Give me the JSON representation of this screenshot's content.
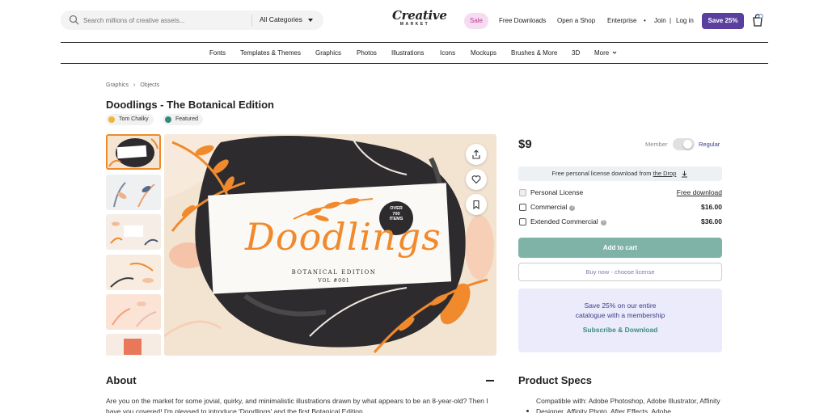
{
  "header": {
    "search_placeholder": "Search millions of creative assets...",
    "category_select": "All Categories",
    "logo_line1": "Creative",
    "logo_line2": "MARKET",
    "sale": "Sale",
    "free_downloads": "Free Downloads",
    "open_shop": "Open a Shop",
    "enterprise": "Enterprise",
    "bullet": "•",
    "join": "Join",
    "pipe": "|",
    "login": "Log in",
    "save_button": "Save 25%"
  },
  "category_nav": [
    "Fonts",
    "Templates & Themes",
    "Graphics",
    "Photos",
    "Illustrations",
    "Icons",
    "Mockups",
    "Brushes & More",
    "3D",
    "More"
  ],
  "breadcrumb": [
    "Graphics",
    "Objects"
  ],
  "product": {
    "title": "Doodlings - The Botanical Edition",
    "author": "Tom Chalky",
    "badge": "Featured",
    "hero_script": "Doodlings",
    "hero_subtitle": "BOTANICAL EDITION",
    "hero_volume": "VOL #001",
    "hero_badge_lines": [
      "OVER",
      "700",
      "ITEMS"
    ]
  },
  "purchase": {
    "price": "$9",
    "member_label": "Member",
    "regular_label": "Regular",
    "free_banner_text": "Free personal license download from ",
    "free_banner_link": "the Drop",
    "licenses": [
      {
        "name": "Personal License",
        "value": "Free download",
        "info": false
      },
      {
        "name": "Commercial",
        "value": "$16.00",
        "info": true
      },
      {
        "name": "Extended Commercial",
        "value": "$36.00",
        "info": true
      }
    ],
    "add_to_cart": "Add to cart",
    "buy_now": "Buy now - choose license",
    "promo_line1": "Save 25% on our entire",
    "promo_line2": "catalogue with a membership",
    "promo_cta": "Subscribe & Download"
  },
  "about": {
    "heading": "About",
    "text": "Are you on the market for some jovial, quirky, and minimalistic illustrations drawn by what appears to be an 8-year-old? Then I have you covered! I'm pleased to introduce 'Doodlings' and the first Botanical Edition."
  },
  "specs": {
    "heading": "Product Specs",
    "text": "Compatible with: Adobe Photoshop, Adobe Illustrator, Affinity Designer, Affinity Photo, After Effects, Adobe"
  },
  "colors": {
    "brand_purple": "#5a3f9e",
    "accent_orange": "#f08a2c",
    "cart_green": "#7fb3a8",
    "promo_bg": "#ebebfb"
  }
}
